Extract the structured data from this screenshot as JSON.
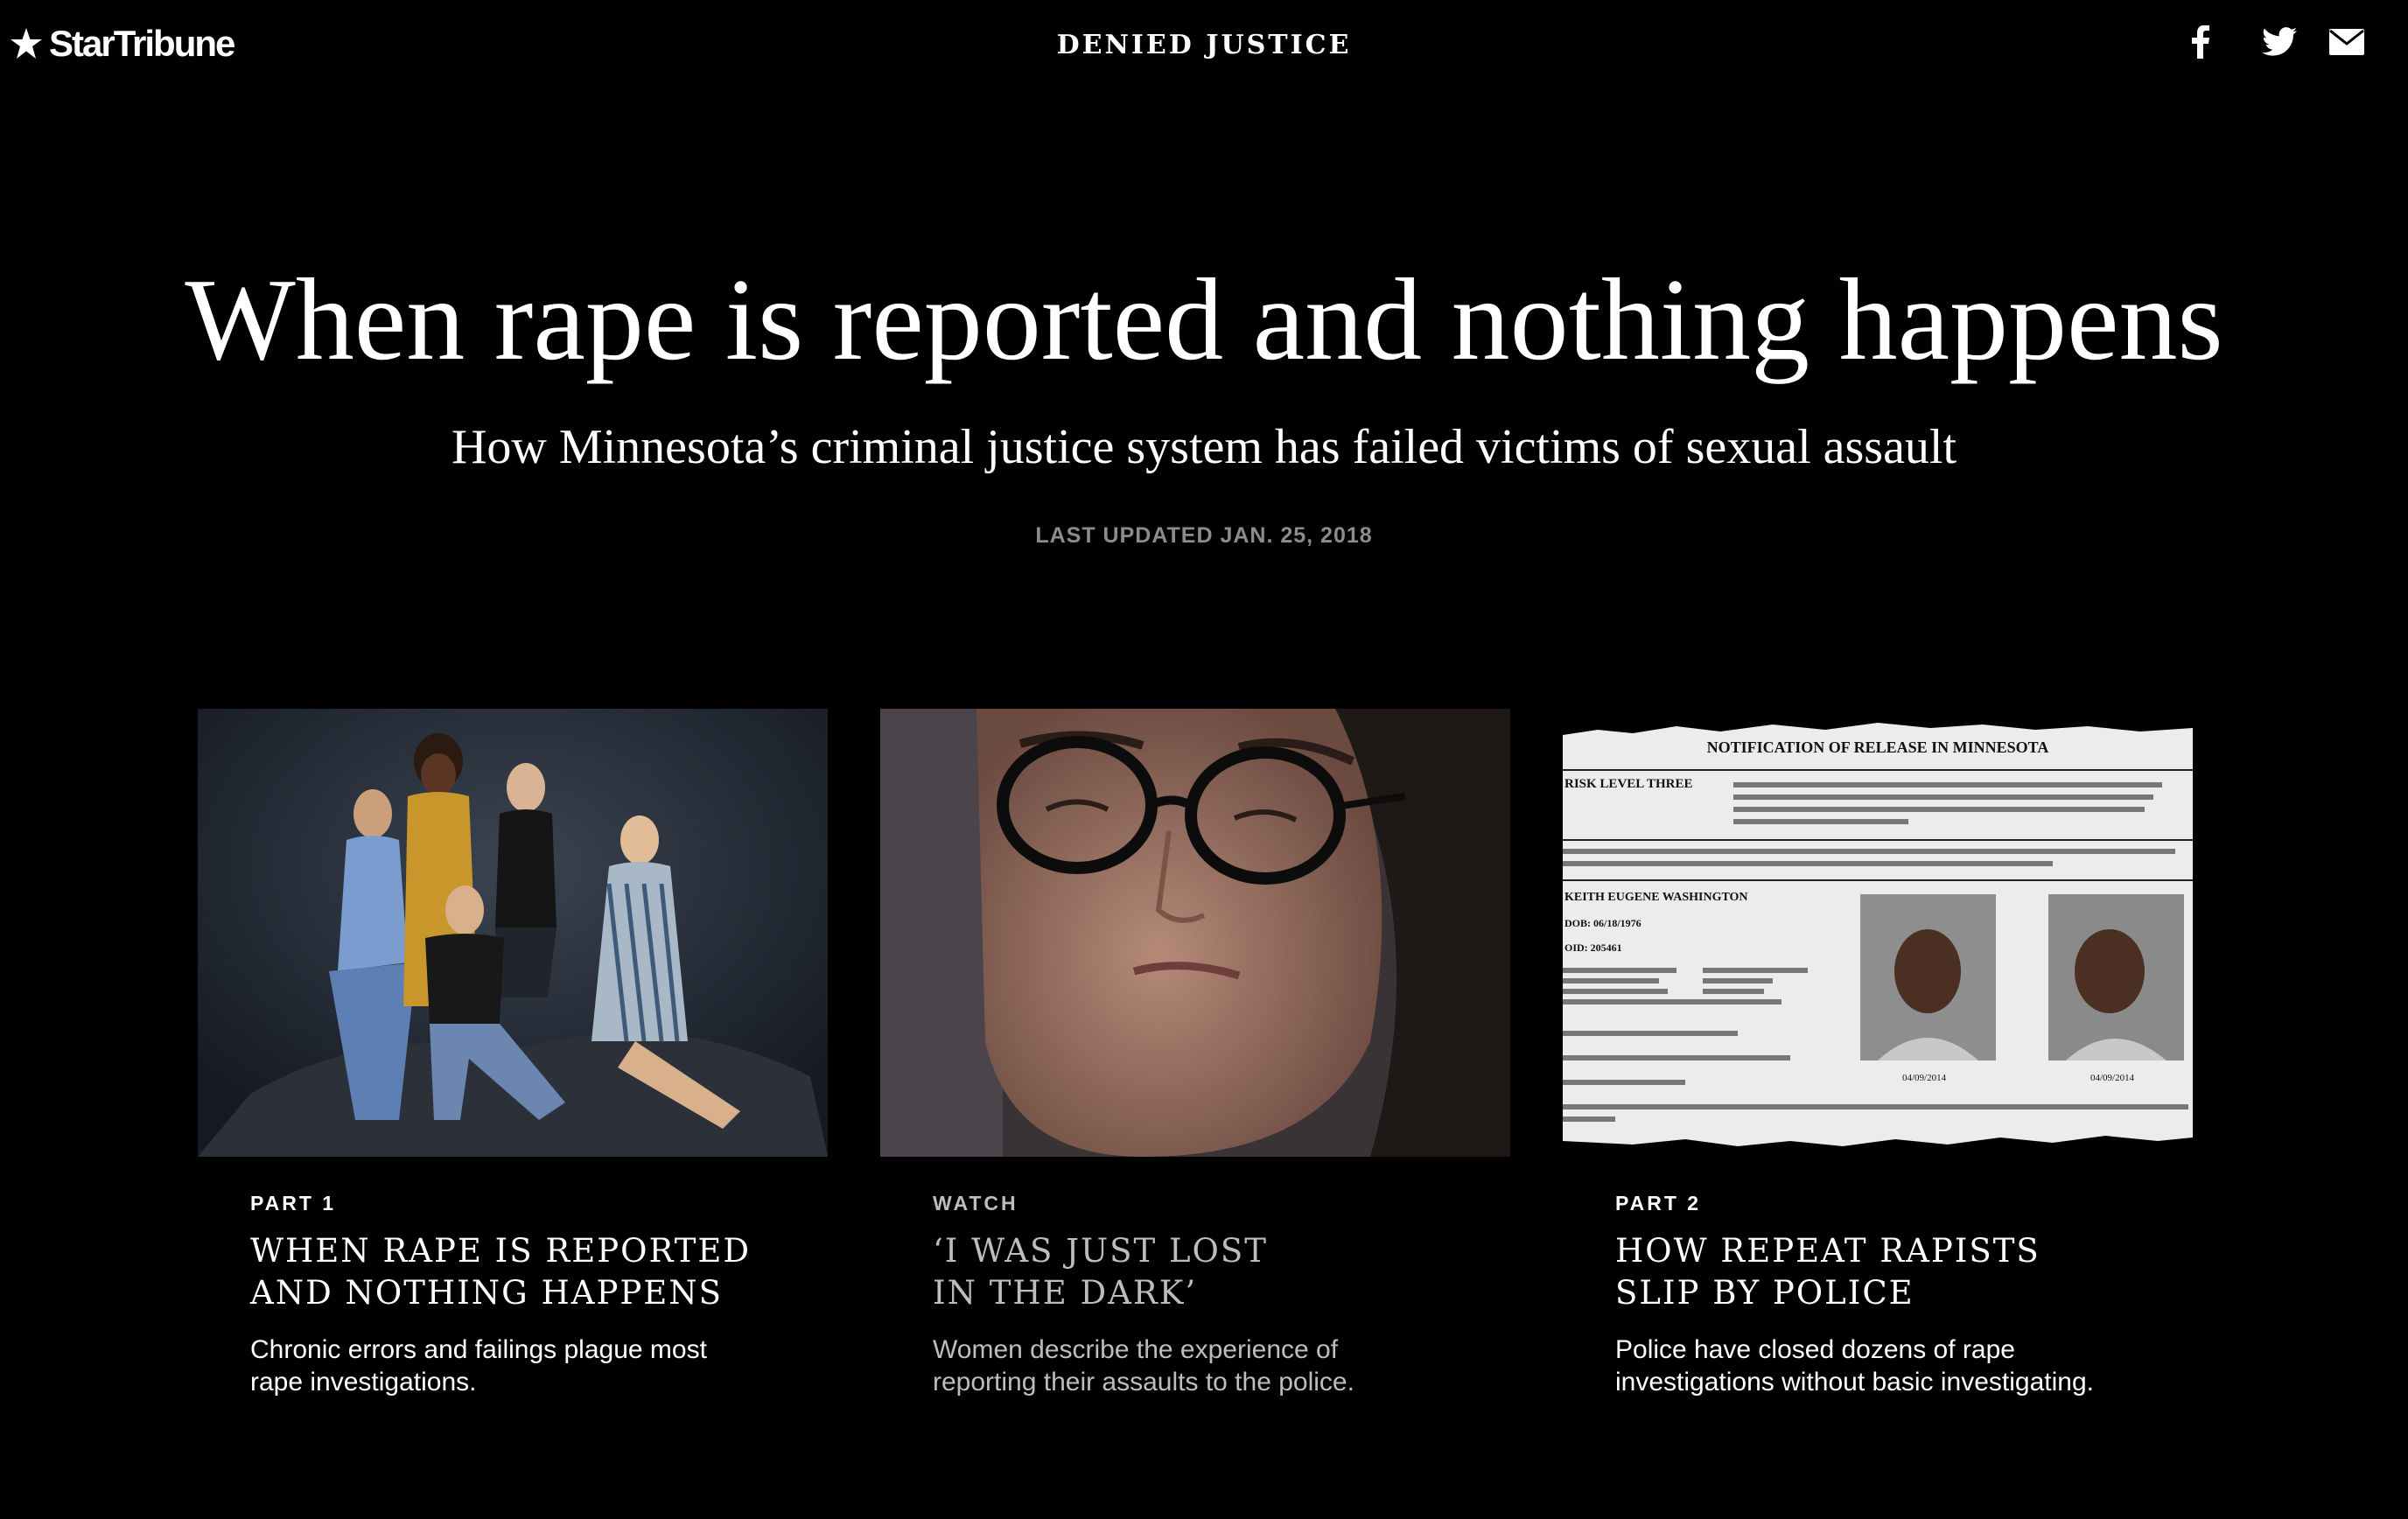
{
  "header": {
    "logo_text": "StarTribune",
    "section_title": "DENIED JUSTICE",
    "social": [
      {
        "icon": "facebook-icon"
      },
      {
        "icon": "twitter-icon"
      },
      {
        "icon": "email-icon"
      }
    ]
  },
  "hero": {
    "headline": "When rape is reported and nothing happens",
    "subhead": "How Minnesota’s criminal justice system has failed victims of sexual assault",
    "updated": "LAST UPDATED JAN. 25, 2018"
  },
  "cards": [
    {
      "kicker": "PART 1",
      "title_line1": "WHEN RAPE IS REPORTED",
      "title_line2": "AND NOTHING HAPPENS",
      "dek_line1": "Chronic errors and failings plague most",
      "dek_line2": "rape investigations."
    },
    {
      "kicker": "WATCH",
      "title_line1": "‘I WAS JUST LOST",
      "title_line2": "IN THE DARK’",
      "dek_line1": "Women describe the experience of",
      "dek_line2": "reporting their assaults to the police."
    },
    {
      "kicker": "PART 2",
      "title_line1": "HOW REPEAT RAPISTS",
      "title_line2": "SLIP BY POLICE",
      "dek_line1": "Police have closed dozens of rape",
      "dek_line2": "investigations without basic investigating."
    }
  ],
  "document": {
    "title": "NOTIFICATION OF RELEASE IN MINNESOTA",
    "risk": "RISK LEVEL THREE",
    "name": "KEITH EUGENE WASHINGTON",
    "dob": "DOB: 06/18/1976",
    "oid": "OID: 205461",
    "photo_date_1": "04/09/2014",
    "photo_date_2": "04/09/2014"
  }
}
